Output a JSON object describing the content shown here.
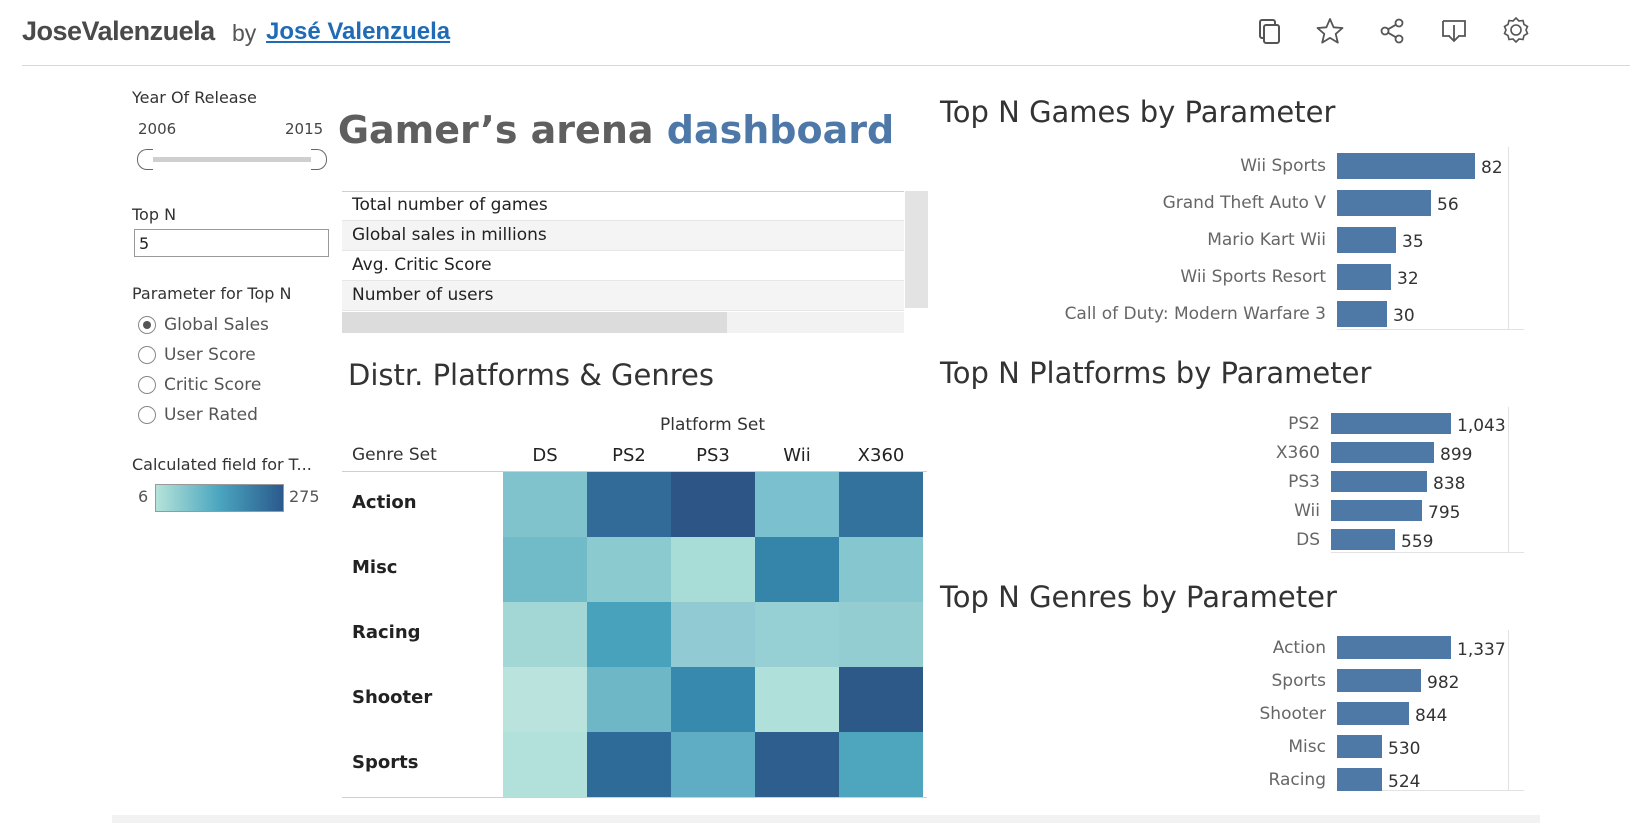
{
  "header": {
    "brand": "JoseValenzuela",
    "by": "by",
    "author": "José Valenzuela",
    "icons": [
      "copy-icon",
      "star-icon",
      "share-icon",
      "download-icon",
      "award-icon"
    ]
  },
  "filters": {
    "year": {
      "label": "Year Of Release",
      "min": "2006",
      "max": "2015"
    },
    "topn": {
      "label": "Top N",
      "value": "5"
    },
    "parameter": {
      "label": "Parameter for Top N",
      "options": [
        "Global Sales",
        "User Score",
        "Critic Score",
        "User Rated"
      ],
      "selected": "Global Sales"
    },
    "legend": {
      "label": "Calculated field for T...",
      "min": "6",
      "max": "275"
    }
  },
  "title": {
    "part1": "Gamer’s arena ",
    "part2": "dashboard",
    "accent_color": "#4d78a8"
  },
  "kpis": [
    "Total number of games",
    "Global sales in millions",
    "Avg. Critic Score",
    "Number of users"
  ],
  "heatmap": {
    "title": "Distr. Platforms & Genres",
    "col_header": "Platform Set",
    "row_header": "Genre Set",
    "columns": [
      "DS",
      "PS2",
      "PS3",
      "Wii",
      "X360"
    ],
    "rows": [
      "Action",
      "Misc",
      "Racing",
      "Shooter",
      "Sports"
    ],
    "colors": [
      [
        "#80c3cc",
        "#336b98",
        "#2d5686",
        "#7ac0ce",
        "#34729e"
      ],
      [
        "#71bac8",
        "#8bcbd0",
        "#a8dcd7",
        "#3585ab",
        "#86c7cf"
      ],
      [
        "#a3d7d6",
        "#49a2bc",
        "#91cad2",
        "#97d0d4",
        "#94cdd1"
      ],
      [
        "#b9e3dc",
        "#6db7c7",
        "#3789ad",
        "#afe0da",
        "#2c5987"
      ],
      [
        "#b2e0da",
        "#2f6b99",
        "#5eadc4",
        "#2e5e8e",
        "#4ea5be"
      ]
    ]
  },
  "chart_data": [
    {
      "type": "bar",
      "title": "Top N Games by Parameter",
      "categories": [
        "Wii Sports",
        "Grand Theft Auto V",
        "Mario Kart Wii",
        "Wii Sports Resort",
        "Call of Duty: Modern Warfare 3"
      ],
      "values": [
        82,
        56,
        35,
        32,
        30
      ],
      "labels": [
        "82",
        "56",
        "35",
        "32",
        "30"
      ],
      "color": "#4e79a7"
    },
    {
      "type": "bar",
      "title": "Top N Platforms by Parameter",
      "categories": [
        "PS2",
        "X360",
        "PS3",
        "Wii",
        "DS"
      ],
      "values": [
        1043,
        899,
        838,
        795,
        559
      ],
      "labels": [
        "1,043",
        "899",
        "838",
        "795",
        "559"
      ],
      "color": "#4e79a7"
    },
    {
      "type": "bar",
      "title": "Top N Genres by Parameter",
      "categories": [
        "Action",
        "Sports",
        "Shooter",
        "Misc",
        "Racing"
      ],
      "values": [
        1337,
        982,
        844,
        530,
        524
      ],
      "labels": [
        "1,337",
        "982",
        "844",
        "530",
        "524"
      ],
      "color": "#4e79a7"
    }
  ]
}
